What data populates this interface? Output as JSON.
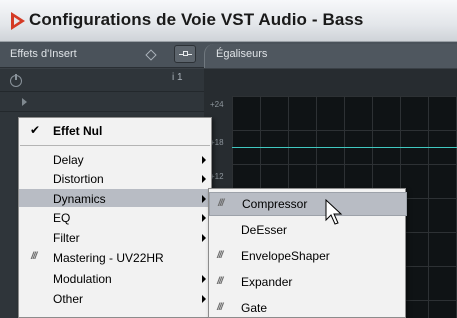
{
  "window": {
    "title": "Configurations de Voie VST Audio - Bass"
  },
  "header": {
    "insert_label": "Effets d'Insert",
    "eq_label": "Égaliseurs"
  },
  "slot": {
    "number": "i 1"
  },
  "eq": {
    "db_labels": [
      "+24",
      "+18",
      "+12"
    ]
  },
  "menu": {
    "items": [
      {
        "label": "Effet Nul",
        "checked": true
      },
      {
        "label": "Delay",
        "submenu": true
      },
      {
        "label": "Distortion",
        "submenu": true
      },
      {
        "label": "Dynamics",
        "submenu": true,
        "selected": true
      },
      {
        "label": "EQ",
        "submenu": true
      },
      {
        "label": "Filter",
        "submenu": true
      },
      {
        "label": "Mastering - UV22HR",
        "plugin_icon": "///"
      },
      {
        "label": "Modulation",
        "submenu": true
      },
      {
        "label": "Other",
        "submenu": true
      }
    ]
  },
  "submenu": {
    "items": [
      {
        "label": "Compressor",
        "plugin_icon": "///",
        "highlighted": true
      },
      {
        "label": "DeEsser"
      },
      {
        "label": "EnvelopeShaper",
        "plugin_icon": "///"
      },
      {
        "label": "Expander",
        "plugin_icon": "///"
      },
      {
        "label": "Gate",
        "plugin_icon": "///"
      }
    ]
  }
}
